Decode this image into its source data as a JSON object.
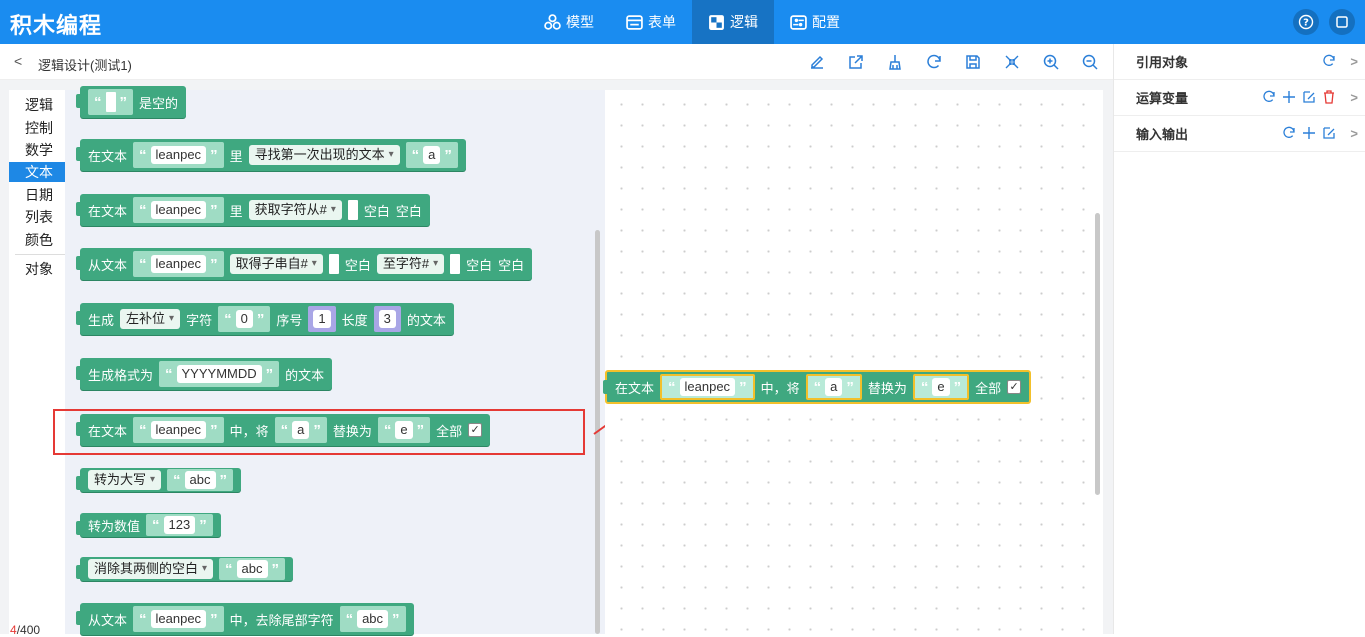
{
  "app": {
    "title": "积木编程"
  },
  "nav": [
    {
      "label": "模型",
      "icon": "model-icon"
    },
    {
      "label": "表单",
      "icon": "form-icon"
    },
    {
      "label": "逻辑",
      "icon": "logic-icon"
    },
    {
      "label": "配置",
      "icon": "config-icon"
    }
  ],
  "nav_active": "逻辑",
  "breadcrumb": {
    "back": "<",
    "title": "逻辑设计(测试1)"
  },
  "toolbar": [
    "edit-icon",
    "export-icon",
    "clean-icon",
    "refresh-icon",
    "save-icon",
    "collapse-icon",
    "zoom-in-icon",
    "zoom-out-icon"
  ],
  "categories": [
    "逻辑",
    "控制",
    "数学",
    "文本",
    "日期",
    "列表",
    "颜色",
    "对象"
  ],
  "active_category": "文本",
  "colors": {
    "primary": "#1a8cf0",
    "block": "#3fa880",
    "highlight": "#e53935",
    "selected": "#f2c02b"
  },
  "blocks": {
    "b0": {
      "label": "是空的"
    },
    "b1": {
      "pre": "在文本",
      "value": "leanpec",
      "mid": "里",
      "drop": "寻找第一次出现的文本",
      "value2": "a"
    },
    "b2": {
      "pre": "在文本",
      "value": "leanpec",
      "mid": "里",
      "drop": "获取字符从#",
      "post1": "空白",
      "post2": "空白"
    },
    "b3": {
      "pre": "从文本",
      "value": "leanpec",
      "drop": "取得子串自#",
      "mid": "空白",
      "drop2": "至字符#",
      "post1": "空白",
      "post2": "空白"
    },
    "b4": {
      "pre": "生成",
      "drop": "左补位",
      "l1": "字符",
      "v1": "0",
      "l2": "序号",
      "v2": "1",
      "l3": "长度",
      "v3": "3",
      "post": "的文本"
    },
    "b5": {
      "pre": "生成格式为",
      "value": "YYYYMMDD",
      "post": "的文本"
    },
    "b6": {
      "pre": "在文本",
      "value": "leanpec",
      "mid": "中，将",
      "value2": "a",
      "mid2": "替换为",
      "value3": "e",
      "post": "全部"
    },
    "b7": {
      "drop": "转为大写",
      "value": "abc"
    },
    "b8": {
      "pre": "转为数值",
      "value": "123"
    },
    "b9": {
      "drop": "消除其两侧的空白",
      "value": "abc"
    },
    "b10": {
      "pre": "从文本",
      "value": "leanpec",
      "mid": "中，去除尾部字符",
      "value2": "abc"
    }
  },
  "canvas_block": {
    "pre": "在文本",
    "value": "leanpec",
    "mid": "中，将",
    "value2": "a",
    "mid2": "替换为",
    "value3": "e",
    "post": "全部"
  },
  "counter": {
    "current": "4",
    "total": "/400"
  },
  "right_panel": [
    {
      "label": "引用对象"
    },
    {
      "label": "运算变量"
    },
    {
      "label": "输入输出"
    }
  ],
  "quote_open": "“",
  "quote_close": "”",
  "check": "✓"
}
